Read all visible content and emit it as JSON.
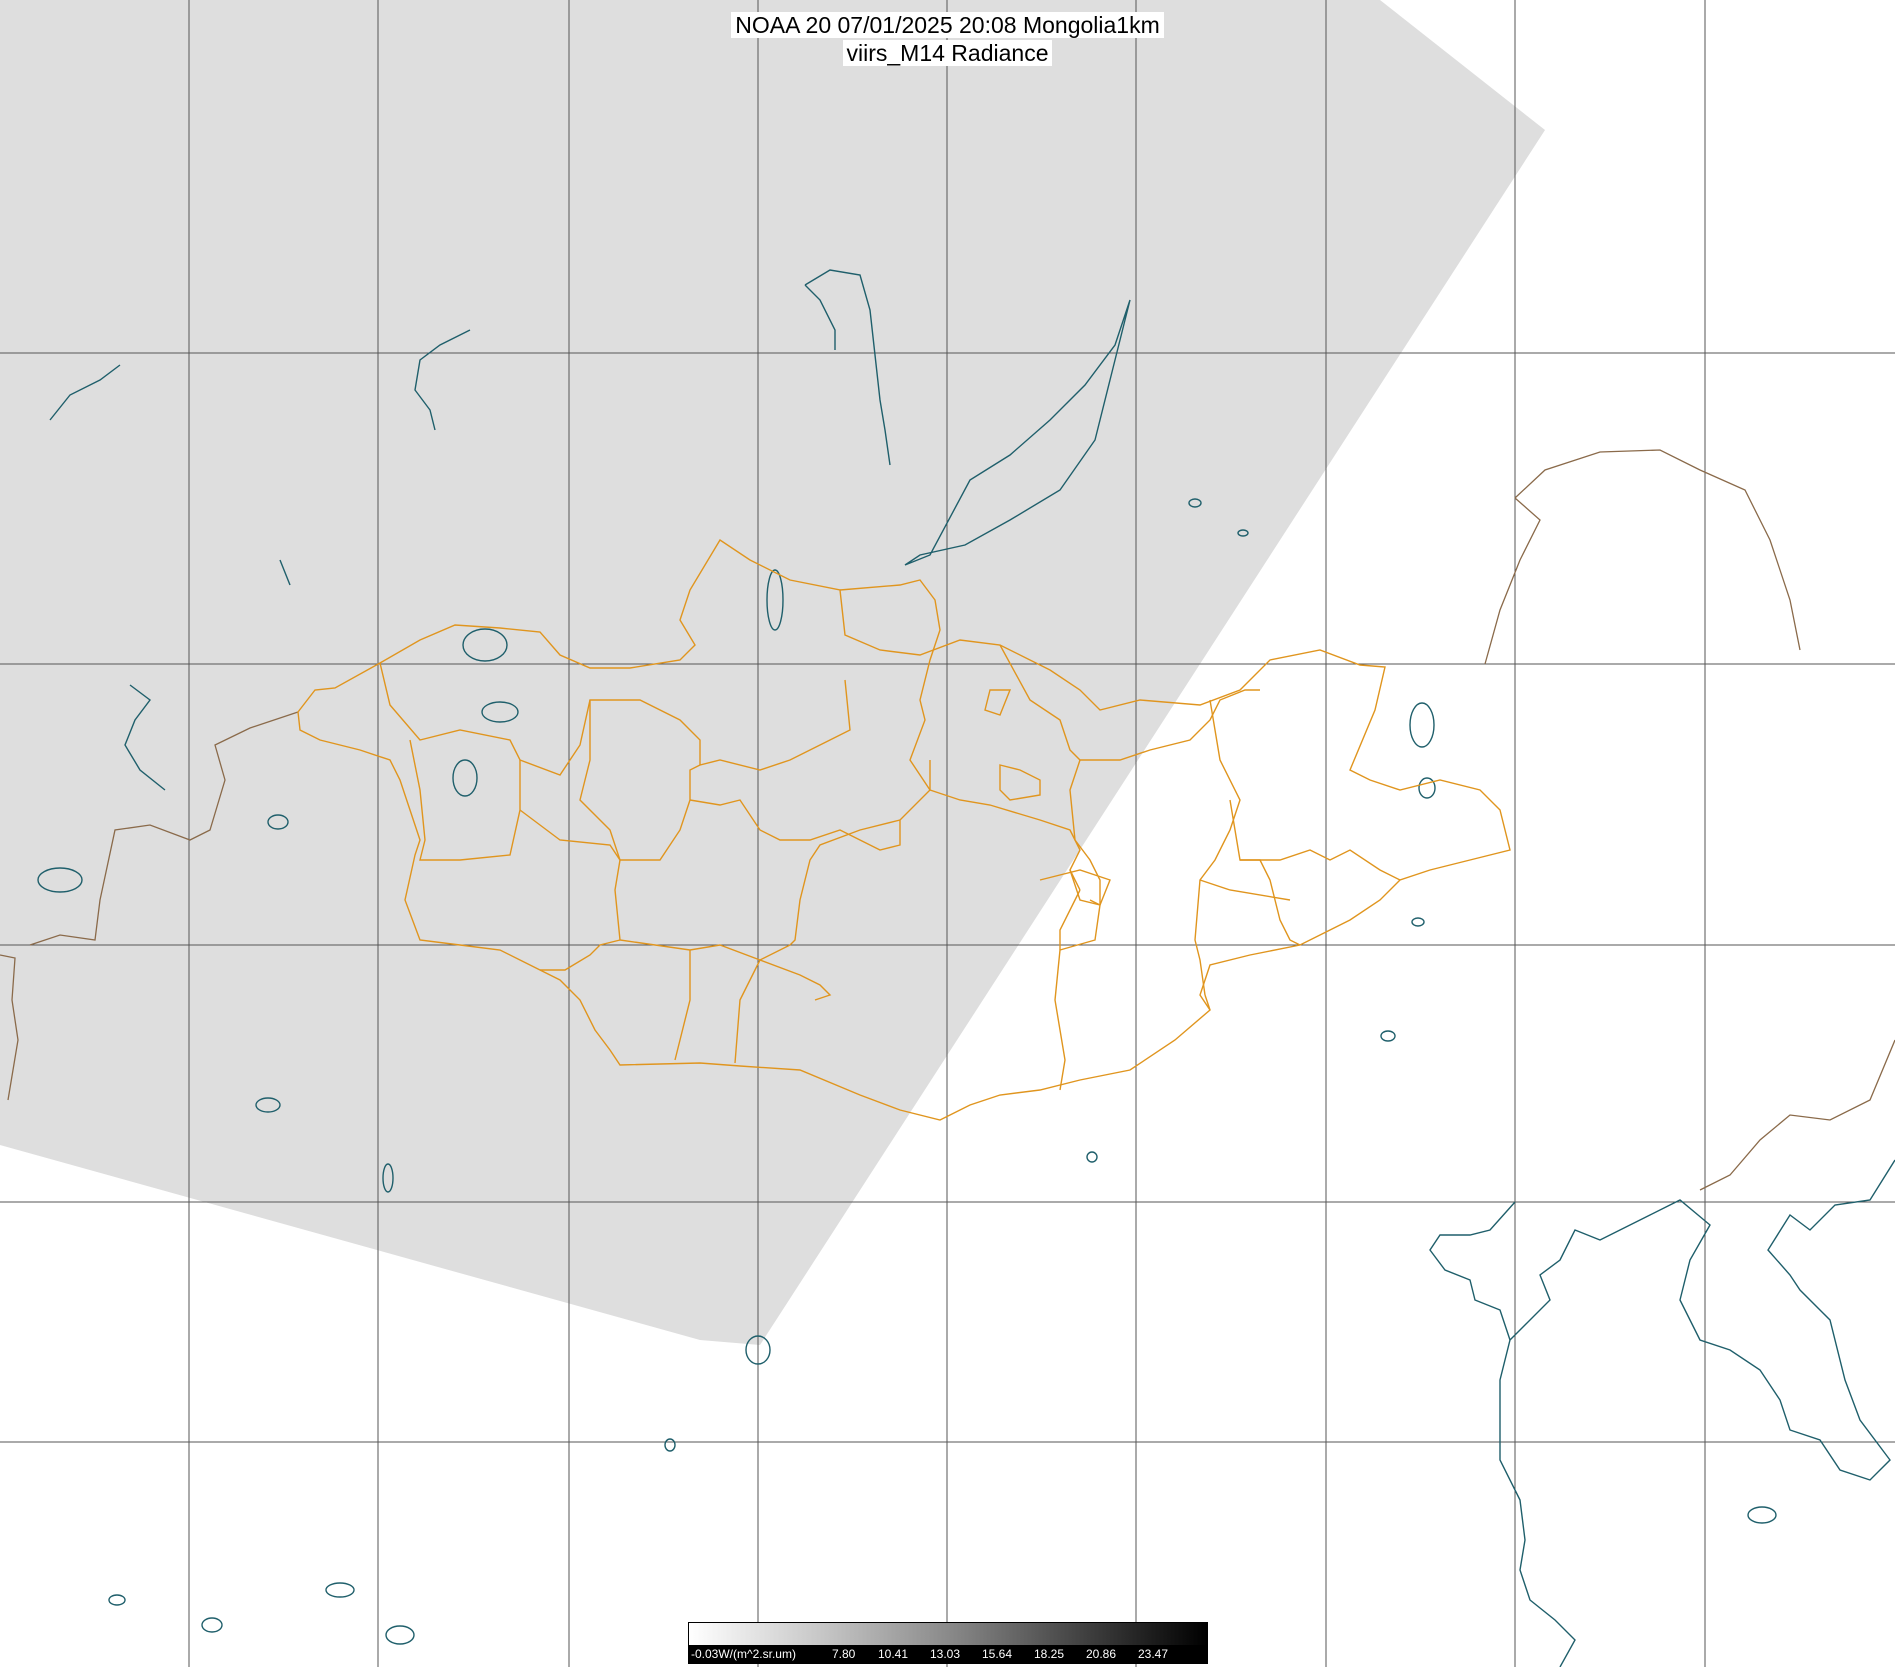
{
  "title": {
    "line1": "NOAA 20 07/01/2025 20:08 Mongolia1km",
    "line2": "viirs_M14 Radiance"
  },
  "colorbar": {
    "unit_label": "-0.03W/(m^2.sr.um)",
    "tick_labels": [
      "7.80",
      "10.41",
      "13.03",
      "15.64",
      "18.25",
      "20.86",
      "23.47"
    ]
  },
  "colors": {
    "swath": "#dedede",
    "grid": "#555555",
    "coast": "#1f5f6b",
    "provinces": "#e0951e",
    "borders": "#8a6a4a"
  }
}
